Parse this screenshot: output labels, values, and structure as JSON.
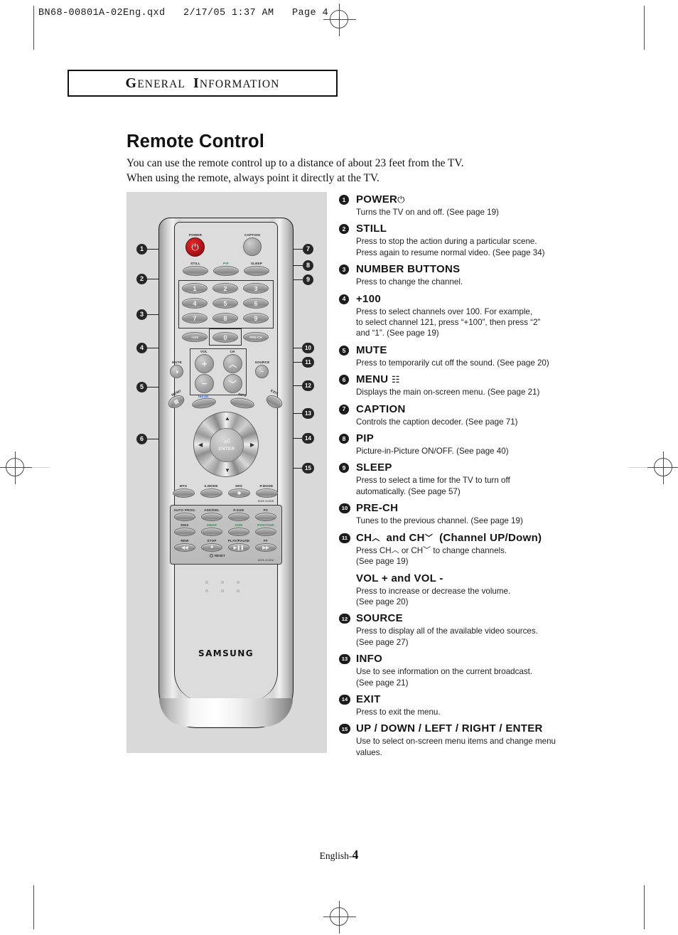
{
  "running_head": "BN68-00801A-02Eng.qxd   2/17/05 1:37 AM   Page 4",
  "chapter": {
    "first1": "G",
    "rest1": "ENERAL",
    "first2": "I",
    "rest2": "NFORMATION"
  },
  "page_title": "Remote Control",
  "intro_line1": "You can use the remote control up to a distance of about 23 feet from the TV.",
  "intro_line2": "When using the remote, always point it directly at the TV.",
  "footer": {
    "language": "English-",
    "page_number": "4"
  },
  "remote": {
    "brand": "SAMSUNG",
    "reset_label": "RESET",
    "model_code_top": "BN59-00483B",
    "model_code_bottom": "BN59-00483A",
    "buttons": {
      "power": "POWER",
      "caption": "CAPTION",
      "still": "STILL",
      "pip": "PIP",
      "sleep": "SLEEP",
      "numbers": [
        "1",
        "2",
        "3",
        "4",
        "5",
        "6",
        "7",
        "8",
        "9"
      ],
      "plus100": "+100",
      "zero": "0",
      "prech": "PRE-CH",
      "vol": "VOL",
      "ch": "CH",
      "mute": "MUTE",
      "source": "SOURCE",
      "menu": "MENU",
      "info": "INFO",
      "exit": "EXIT",
      "enter": "ENTER",
      "fav": "fav.ch",
      "row_mts": [
        "MTS",
        "S.MODE",
        "SRS",
        "P.MODE"
      ],
      "row_auto": [
        "AUTO PROG.",
        "ADD/DEL",
        "P.SIZE",
        "PC"
      ],
      "row_dnie": [
        "DNIe",
        "SWAP",
        "SIZE",
        "POSITION"
      ],
      "row_trans": [
        "REW",
        "STOP",
        "PLAY/PAUSE",
        "FF"
      ]
    },
    "callouts_left": [
      "1",
      "2",
      "3",
      "4",
      "5",
      "6"
    ],
    "callouts_right": [
      "7",
      "8",
      "9",
      "10",
      "11",
      "12",
      "13",
      "14",
      "15"
    ]
  },
  "legend": [
    {
      "num": "1",
      "title": "POWER",
      "glyph": "⏻",
      "body": [
        "Turns the TV on and off. (See page 19)"
      ]
    },
    {
      "num": "2",
      "title": "STILL",
      "glyph": "",
      "body": [
        "Press to stop the action during a particular scene.",
        "Press again to resume normal video. (See page 34)"
      ]
    },
    {
      "num": "3",
      "title": "NUMBER BUTTONS",
      "glyph": "",
      "body": [
        "Press to change the channel."
      ]
    },
    {
      "num": "4",
      "title": "+100",
      "glyph": "",
      "body": [
        "Press to select channels over 100. For example,",
        "to select channel 121, press “+100”, then press “2”",
        "and “1”. (See page 19)"
      ]
    },
    {
      "num": "5",
      "title": "MUTE",
      "glyph": "",
      "body": [
        "Press to temporarily cut off the sound. (See page 20)"
      ]
    },
    {
      "num": "6",
      "title": "MENU",
      "glyph": "☷",
      "body": [
        "Displays the main on-screen menu. (See page 21)"
      ]
    },
    {
      "num": "7",
      "title": "CAPTION",
      "glyph": "",
      "body": [
        "Controls the caption decoder. (See page 71)"
      ]
    },
    {
      "num": "8",
      "title": "PIP",
      "glyph": "",
      "body": [
        "Picture-in-Picture ON/OFF. (See page 40)"
      ]
    },
    {
      "num": "9",
      "title": "SLEEP",
      "glyph": "",
      "body": [
        "Press to select a time for the TV to turn off",
        "automatically. (See page 57)"
      ]
    },
    {
      "num": "10",
      "title": "PRE-CH",
      "glyph": "",
      "body": [
        "Tunes to the previous channel. (See page 19)"
      ]
    }
  ],
  "legend_ch": {
    "num": "11",
    "title_a": "CH",
    "title_b": "and CH",
    "title_c": "(Channel UP/Down)",
    "body_a": "Press CH",
    "body_b": "or CH",
    "body_c": "to change channels.",
    "body_d": "(See page 19)",
    "vol_title": "VOL + and VOL -",
    "vol_body1": "Press to increase or decrease the volume.",
    "vol_body2": "(See page 20)"
  },
  "legend_tail": [
    {
      "num": "12",
      "title": "SOURCE",
      "glyph": "",
      "body": [
        "Press to display all of the available video sources.",
        "(See page 27)"
      ]
    },
    {
      "num": "13",
      "title": "INFO",
      "glyph": "",
      "body": [
        "Use to see information on the current broadcast.",
        "(See page 21)"
      ]
    },
    {
      "num": "14",
      "title": "EXIT",
      "glyph": "",
      "body": [
        "Press to exit the menu."
      ]
    },
    {
      "num": "15",
      "title": "UP / DOWN / LEFT / RIGHT / ENTER",
      "glyph": "",
      "body": [
        "Use to select on-screen menu items and change menu",
        "values."
      ]
    }
  ]
}
